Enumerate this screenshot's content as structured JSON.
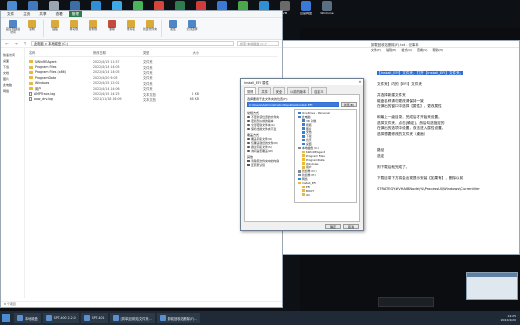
{
  "desktop_icons": [
    {
      "label": "此电脑",
      "color": "#4a8bd1"
    },
    {
      "label": "网络",
      "color": "#3f7ac0"
    },
    {
      "label": "回收站",
      "color": "#9aa6b2"
    },
    {
      "label": "控制面板",
      "color": "#3a6ea5"
    },
    {
      "label": "Edge",
      "color": "#2f8fd6"
    },
    {
      "label": "腾讯QQ",
      "color": "#3caae8"
    },
    {
      "label": "微信",
      "color": "#48b55b"
    },
    {
      "label": "WPS",
      "color": "#d6453a"
    },
    {
      "label": "EX",
      "color": "#2f7d4f"
    },
    {
      "label": "网易云",
      "color": "#d13b3b"
    },
    {
      "label": "迅雷",
      "color": "#3a7ad6"
    },
    {
      "label": "爱奇艺",
      "color": "#4aa84a"
    },
    {
      "label": "钉钉",
      "color": "#2f8fd6"
    },
    {
      "label": "VM",
      "color": "#6a6a6a"
    },
    {
      "label": "百度网盘",
      "color": "#3a7ad6"
    },
    {
      "label": "WinCone",
      "color": "#5b6f84"
    }
  ],
  "explorer": {
    "tabs": [
      "文件",
      "主页",
      "共享",
      "查看",
      "管理"
    ],
    "active_tab": "管理",
    "ribbon": [
      {
        "label": "固定到快速访问",
        "kind": "b"
      },
      {
        "label": "复制",
        "kind": "y"
      },
      {
        "label": "粘贴",
        "kind": "y"
      },
      {
        "label": "移动到",
        "kind": "y"
      },
      {
        "label": "复制到",
        "kind": "y"
      },
      {
        "label": "删除",
        "kind": "r"
      },
      {
        "label": "重命名",
        "kind": "y"
      },
      {
        "label": "新建文件夹",
        "kind": "y"
      },
      {
        "label": "属性",
        "kind": "b"
      },
      {
        "label": "全部选择",
        "kind": "b"
      }
    ],
    "address": "此电脑 > 本地磁盘 (C:)",
    "search_placeholder": "搜索\"本地磁盘 (C:)\"",
    "nav": [
      "快速访问",
      "桌面",
      "下载",
      "文档",
      "图片",
      "此电脑",
      "网络"
    ],
    "columns": {
      "name": "名称",
      "date": "修改日期",
      "type": "类型",
      "size": "大小"
    },
    "files": [
      {
        "name": "$WinREAgent",
        "date": "2022/4/15 11:57",
        "type": "文件夹",
        "size": "",
        "icon": "folder"
      },
      {
        "name": "Program Files",
        "date": "2022/4/14 14:05",
        "type": "文件夹",
        "size": "",
        "icon": "folder"
      },
      {
        "name": "Program Files (x86)",
        "date": "2022/4/14 14:05",
        "type": "文件夹",
        "size": "",
        "icon": "folder"
      },
      {
        "name": "ProgramData",
        "date": "2022/4/20 9:05",
        "type": "文件夹",
        "size": "",
        "icon": "folder"
      },
      {
        "name": "Windows",
        "date": "2022/4/15 12:01",
        "type": "文件夹",
        "size": "",
        "icon": "folder"
      },
      {
        "name": "用户",
        "date": "2022/4/14 14:06",
        "type": "文件夹",
        "size": "",
        "icon": "folder"
      },
      {
        "name": "AMPTrace.log",
        "date": "2022/4/15 14:25",
        "type": "文本文档",
        "size": "1 KB",
        "icon": "doc"
      },
      {
        "name": "aow_drv.log",
        "date": "2021/11/18 16:09",
        "type": "文本文档",
        "size": "68 KB",
        "icon": "doc"
      }
    ],
    "status": "8 个项目"
  },
  "notepad": {
    "title": "卸载回收站删除(F).txt - 记事本",
    "menu": [
      "文件(F)",
      "编辑(E)",
      "格式(O)",
      "查看(V)",
      "帮助(H)"
    ],
    "lines": [
      {
        "text": "【Install_EFI】文件夹，打开【Install_EFI】文件夹。",
        "hl": true
      },
      {
        "text": "",
        "hl": false
      },
      {
        "text": "文件夹】内的【EFI】文件夹",
        "hl": false
      },
      {
        "text": "",
        "hl": false
      },
      {
        "text": "并选择新建文件夹",
        "hl": false
      },
      {
        "text": "磁盘名称请勿更改请保持一致",
        "hl": false
      },
      {
        "text": "在弹出的窗口中选择【属性】，更改属性",
        "hl": false
      },
      {
        "text": "",
        "hl": false
      },
      {
        "text": "和最上一级目录，完成后才开始来设置。",
        "hl": false
      },
      {
        "text": "选择文件夹，点击[确定]，然后勾选指定的",
        "hl": false
      },
      {
        "text": "在弹出的选项中设置，双击进入属性设置。",
        "hl": false
      },
      {
        "text": "选择想要修改的文件夹（桌面）",
        "hl": false
      },
      {
        "text": "",
        "hl": false
      },
      {
        "text": "",
        "hl": false
      },
      {
        "text": "路径",
        "hl": false
      },
      {
        "text": "选定",
        "hl": false
      },
      {
        "text": "",
        "hl": false
      },
      {
        "text": "则下载后就完成了。",
        "hl": false
      },
      {
        "text": "",
        "hl": false
      },
      {
        "text": "下载目录下方将会出现提示安装【如果有】，删除以前",
        "hl": false
      },
      {
        "text": "",
        "hl": false
      },
      {
        "text": "STRATEGY#VHAIBNode\\%\\ProcessUI\\Windows\\CurrentVer",
        "hl": false
      }
    ]
  },
  "dialog": {
    "title": "Install_EFI 属性",
    "tabs": [
      "常规",
      "共享",
      "安全",
      "以前的版本",
      "自定义"
    ],
    "active_tab": "常规",
    "select_label": "选择要用于此文件夹的位置(F):",
    "select_value": "C:\\Users\\Administrator\\Desktop\\Install_EFI",
    "browse_label": "浏览(B)",
    "group1_title": "常规方式",
    "group1": [
      {
        "label": "不更新该位置的文件夹",
        "on": false
      },
      {
        "label": "更新到以前的版本",
        "on": true
      },
      {
        "label": "全部更新文件夹(A)",
        "on": false
      },
      {
        "label": "保持当前文件夹不变",
        "on": false
      }
    ],
    "group2_title": "覆盖方式",
    "group2": [
      {
        "label": "覆盖同名文件(O)",
        "on": true
      },
      {
        "label": "仅覆盖较旧的文件(N)",
        "on": false
      },
      {
        "label": "跳过同名文件(S)",
        "on": false
      },
      {
        "label": "询问是否覆盖(W)",
        "on": false
      }
    ],
    "group3_title": "其他",
    "group3": [
      {
        "label": "清除原文件夹中的内容",
        "on": false
      },
      {
        "label": "还原默认值",
        "on": false
      }
    ],
    "tree": [
      {
        "label": "OneDrive - Personal",
        "c": "blue"
      },
      {
        "label": "此电脑",
        "c": "blue"
      },
      {
        "label": "3D 对象",
        "c": "blue"
      },
      {
        "label": "视频",
        "c": "blue"
      },
      {
        "label": "图片",
        "c": "blue"
      },
      {
        "label": "文档",
        "c": "blue"
      },
      {
        "label": "下载",
        "c": "blue"
      },
      {
        "label": "音乐",
        "c": "blue"
      },
      {
        "label": "桌面",
        "c": "blue"
      },
      {
        "label": "本地磁盘 (C:)",
        "c": "gray"
      },
      {
        "label": "$WinREAgent",
        "c": "yellow"
      },
      {
        "label": "Program Files",
        "c": "yellow"
      },
      {
        "label": "ProgramData",
        "c": "yellow"
      },
      {
        "label": "Windows",
        "c": "yellow"
      },
      {
        "label": "用户",
        "c": "yellow"
      },
      {
        "label": "新加卷 (D:)",
        "c": "gray"
      },
      {
        "label": "新加卷 (E:)",
        "c": "gray"
      },
      {
        "label": "网络",
        "c": "blue"
      },
      {
        "label": "Install_EFI",
        "c": "yellow"
      },
      {
        "label": "EFI",
        "c": "yellow"
      },
      {
        "label": "BOOT",
        "c": "yellow"
      },
      {
        "label": "OC",
        "c": "yellow"
      }
    ],
    "ok": "确定",
    "cancel": "取消"
  },
  "taskbar": {
    "items": [
      {
        "label": "本地磁盘"
      },
      {
        "label": "SPT-400 2.2.0"
      },
      {
        "label": "SPT-401"
      },
      {
        "label": "[简单]回收站文件夹..."
      },
      {
        "label": "卸载回收站删除(F)..."
      }
    ],
    "time": "14:25",
    "date": "2022/4/20"
  }
}
